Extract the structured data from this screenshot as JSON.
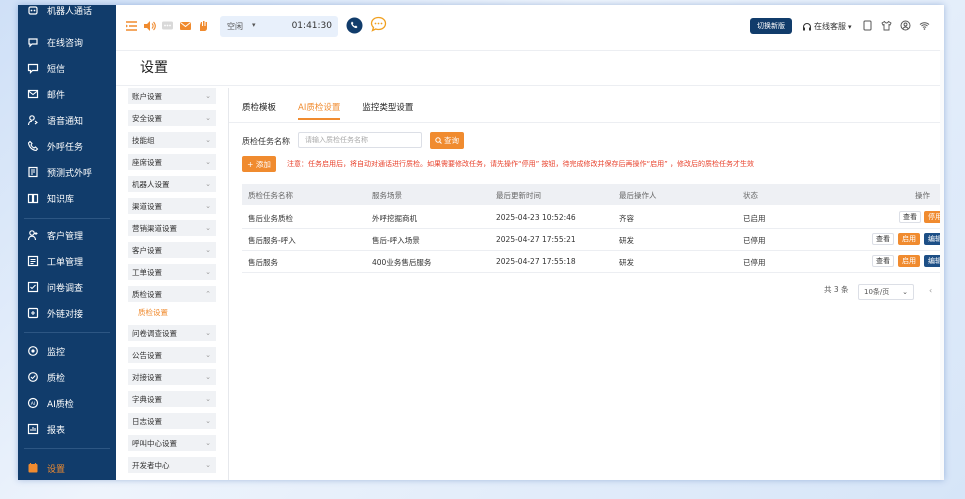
{
  "nav": {
    "items": [
      {
        "label": "机器人通话",
        "icon": "robot-icon"
      },
      {
        "label": "在线咨询",
        "icon": "chat-icon"
      },
      {
        "label": "短信",
        "icon": "sms-icon"
      },
      {
        "label": "邮件",
        "icon": "mail-icon"
      },
      {
        "label": "语音通知",
        "icon": "voice-notify-icon"
      },
      {
        "label": "外呼任务",
        "icon": "phone-icon"
      },
      {
        "label": "预测式外呼",
        "icon": "predict-icon"
      },
      {
        "label": "知识库",
        "icon": "book-icon"
      },
      {
        "label": "客户管理",
        "icon": "customer-icon"
      },
      {
        "label": "工单管理",
        "icon": "ticket-icon"
      },
      {
        "label": "问卷调查",
        "icon": "survey-icon"
      },
      {
        "label": "外链对接",
        "icon": "link-icon"
      },
      {
        "label": "监控",
        "icon": "monitor-icon"
      },
      {
        "label": "质检",
        "icon": "quality-icon"
      },
      {
        "label": "AI质检",
        "icon": "ai-icon"
      },
      {
        "label": "报表",
        "icon": "report-icon"
      },
      {
        "label": "设置",
        "icon": "settings-icon"
      }
    ],
    "active": "设置"
  },
  "topbar": {
    "status": "空闲",
    "timer": "01:41:30",
    "switch_label": "切换新版",
    "online_label": "在线客服",
    "accent": "#f08b2f"
  },
  "page": {
    "title": "设置"
  },
  "settings_menu": {
    "items": [
      "账户设置",
      "安全设置",
      "技能组",
      "座席设置",
      "机器人设置",
      "渠道设置",
      "营销渠道设置",
      "客户设置",
      "工单设置",
      "质检设置"
    ],
    "sub_item": "质检设置",
    "items_after": [
      "问卷调查设置",
      "公告设置",
      "对接设置",
      "字典设置",
      "日志设置",
      "呼叫中心设置",
      "开发者中心"
    ]
  },
  "tabs": [
    {
      "label": "质检模板"
    },
    {
      "label": "AI质检设置"
    },
    {
      "label": "监控类型设置"
    }
  ],
  "active_tab": "AI质检设置",
  "search": {
    "label": "质检任务名称",
    "placeholder": "请输入质检任务名称",
    "button": "查询"
  },
  "add_button": "+ 添加",
  "notice": "注意：任务启用后，将自动对通话进行质检。如果需要修改任务，请先操作“停用” 按钮，待完成修改并保存后再操作“启用” ，修改后的质检任务才生效",
  "table": {
    "headers": [
      "质检任务名称",
      "服务场景",
      "最后更新时间",
      "最后操作人",
      "状态",
      "操作"
    ],
    "rows": [
      {
        "name": "售后业务质检",
        "scene": "外呼挖掘商机",
        "time": "2025-04-23 10:52:46",
        "operator": "齐容",
        "status": "已启用",
        "actions": [
          "查看",
          "停用"
        ]
      },
      {
        "name": "售后服务-呼入",
        "scene": "售后-呼入场景",
        "time": "2025-04-27 17:55:21",
        "operator": "研发",
        "status": "已停用",
        "actions": [
          "查看",
          "启用",
          "编辑"
        ]
      },
      {
        "name": "售后服务",
        "scene": "400业务售后服务",
        "time": "2025-04-27 17:55:18",
        "operator": "研发",
        "status": "已停用",
        "actions": [
          "查看",
          "启用",
          "编辑"
        ]
      }
    ]
  },
  "pager": {
    "total": "共 3 条",
    "page_size": "10条/页"
  }
}
